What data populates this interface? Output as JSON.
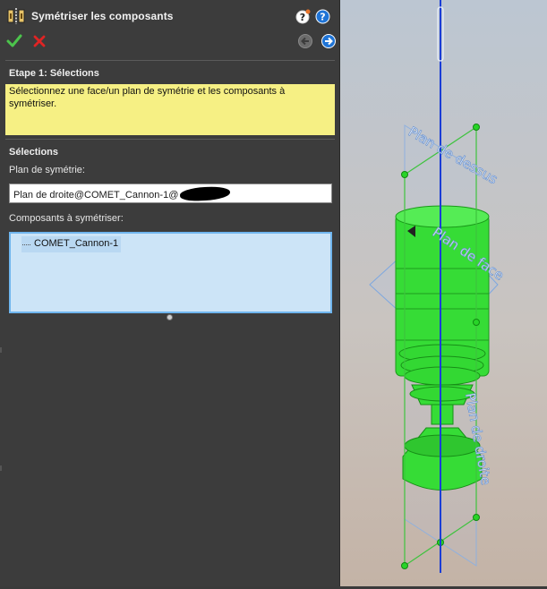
{
  "panel": {
    "title": "Symétriser les composants",
    "step_title": "Etape 1: Sélections",
    "message": "Sélectionnez une face/un plan de symétrie et les composants à symétriser.",
    "selections_title": "Sélections",
    "plane_label": "Plan de symétrie:",
    "plane_value": "Plan de droite@COMET_Cannon-1@",
    "components_label": "Composants à symétriser:",
    "components": [
      "COMET_Cannon-1"
    ]
  },
  "viewport": {
    "plane_labels": [
      "Plan de dessus",
      "Plan de face",
      "Plan de droite"
    ]
  },
  "colors": {
    "panel_bg": "#3c3c3c",
    "message_bg": "#f6f084",
    "list_bg": "#cce4f7",
    "list_border": "#6fb5ee",
    "part_green": "#33e033",
    "plane_blue": "#7da7e0",
    "axis_blue": "#1a3dd6"
  },
  "icons": [
    "mirror-components-icon",
    "help-icon",
    "help-quick-icon",
    "ok-check-icon",
    "cancel-x-icon",
    "back-arrow-icon",
    "next-arrow-icon"
  ]
}
